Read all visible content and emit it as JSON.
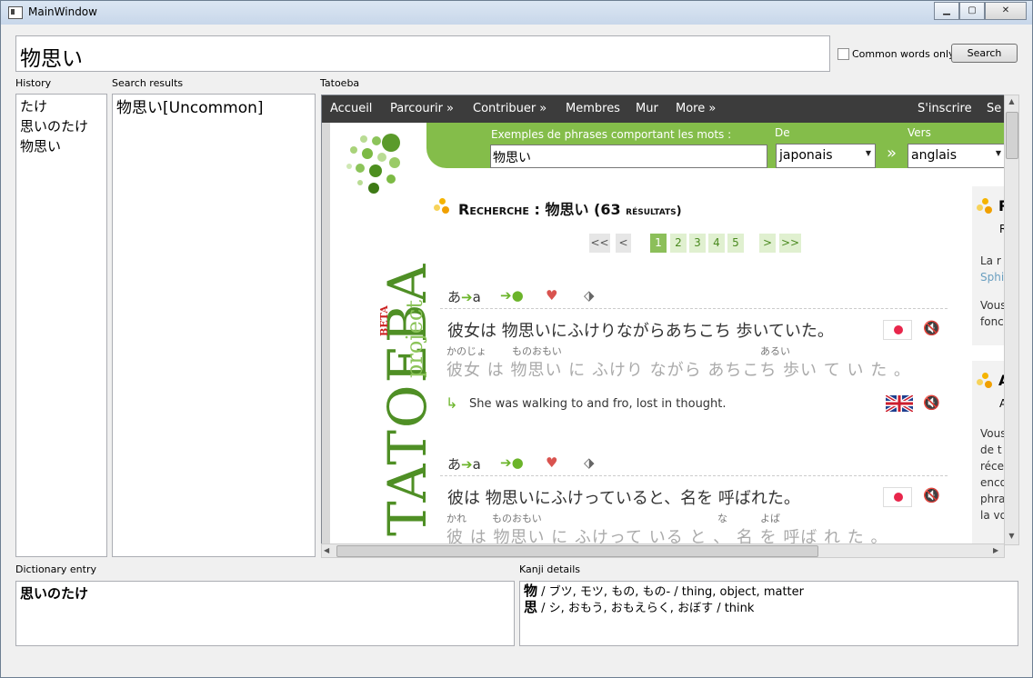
{
  "window": {
    "title": "MainWindow"
  },
  "search": {
    "query": "物思い",
    "common_words_label": "Common words only",
    "search_button": "Search"
  },
  "labels": {
    "history": "History",
    "results": "Search results",
    "tatoeba": "Tatoeba",
    "dictionary": "Dictionary entry",
    "kanji": "Kanji details"
  },
  "history": [
    "たけ",
    "思いのたけ",
    "物思い"
  ],
  "results": [
    "物思い[Uncommon]"
  ],
  "dictionary_entry": "思いのたけ 󠄁",
  "kanji_details": [
    {
      "kanji": "物",
      "text": " / ブツ, モツ, もの, もの- / thing, object, matter"
    },
    {
      "kanji": "思",
      "text": " / シ, おもう, おもえらく, おぼす / think"
    }
  ],
  "tatoeba": {
    "nav": [
      "Accueil",
      "Parcourir »",
      "Contribuer »",
      "Membres",
      "Mur",
      "More »",
      "S'inscrire",
      "Se"
    ],
    "logo_main": "TATOEBA",
    "logo_sub": "project",
    "logo_beta": "BETA",
    "search_label": "Exemples de phrases comportant les mots :",
    "search_value": "物思い",
    "from_label": "De",
    "from_value": "japonais",
    "to_label": "Vers",
    "to_value": "anglais",
    "swap_glyph": "»",
    "heading_prefix": "Recherche : ",
    "heading_query": "物思い",
    "heading_count": " (63 ",
    "heading_suffix": "résultats)",
    "pagination": [
      "<<",
      "<",
      "1",
      "2",
      "3",
      "4",
      "5",
      ">",
      ">>"
    ],
    "current_page": "1",
    "sentences": [
      {
        "japanese": "彼女は 物思いにふけりながらあちこち 歩いていた。",
        "furigana": [
          {
            "text": "かのじょ"
          },
          {
            "text": "ものおもい"
          },
          {
            "text": "あるい"
          }
        ],
        "spaced": "彼女 は  物思い に ふけり ながら あちこち  歩い て い た 。",
        "translation": "She was walking to and fro, lost in thought."
      },
      {
        "japanese": "彼は 物思いにふけっていると、名を 呼ばれた。",
        "furigana": [
          {
            "text": "かれ"
          },
          {
            "text": "ものおもい"
          },
          {
            "text": "な"
          },
          {
            "text": "よば"
          }
        ],
        "spaced": "彼 は  物思い に  ふけって いる と 、 名 を  呼ば れ た 。"
      }
    ],
    "side_texts": [
      "La r",
      "Sphi",
      "Vous",
      "fonc",
      "Vous",
      "de t",
      "réce",
      "enco",
      "phra",
      "la vo"
    ],
    "side_heading_initials": [
      "R",
      "A"
    ],
    "side_sub": [
      "R",
      "A"
    ]
  },
  "colors": {
    "accent_green": "#84bd4a",
    "nav_bg": "#3c3c3c",
    "record_red": "#e8264b"
  }
}
